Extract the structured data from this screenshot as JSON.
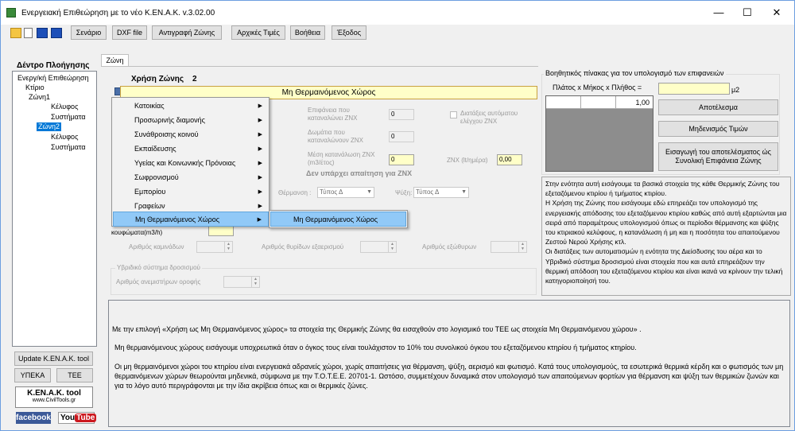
{
  "window": {
    "title": "Ενεργειακή Επιθεώρηση με το νέο Κ.ΕΝ.Α.Κ. v.3.02.00",
    "minimize": "—",
    "maximize": "☐",
    "close": "✕"
  },
  "toolbar": {
    "scenario": "Σενάριο",
    "dxf": "DXF file",
    "copy_zone": "Αντιγραφή Ζώνης",
    "initial_values": "Αρχικές Τιμές",
    "help": "Βοήθεια",
    "exit": "Έξοδος"
  },
  "tree": {
    "title": "Δέντρο Πλοήγησης",
    "items": [
      "Ενεργ/κή Επιθεώρηση",
      "Κτίριο",
      "Ζώνη1",
      "Κέλυφος",
      "Συστήματα",
      "Ζώνη2",
      "Κέλυφος",
      "Συστήματα"
    ]
  },
  "left_buttons": {
    "update": "Update K.EN.A.K. tool",
    "ypeka": "ΥΠΕΚΑ",
    "tee": "ΤΕΕ",
    "logo_title": "K.EN.A.K. tool",
    "logo_sub": "www.CivilTools.gr",
    "facebook": "facebook",
    "youtube_you": "You",
    "youtube_tube": "Tube"
  },
  "tab": {
    "label": "Ζώνη"
  },
  "zone": {
    "usage_label": "Χρήση Ζώνης",
    "number": "2",
    "usage_value": "Μη Θερμαινόμενος Χώρος"
  },
  "context_menu": {
    "items": [
      "Κατοικίας",
      "Προσωρινής διαμονής",
      "Συνάθροισης κοινού",
      "Εκπαίδευσης",
      "Υγείας και Κοινωνικής Πρόνοιας",
      "Σωφρονισμού",
      "Εμπορίου",
      "Γραφείων",
      "Μη Θερμαινόμενος Χώρος"
    ],
    "submenu_item": "Μη Θερμαινόμενος Χώρος"
  },
  "form": {
    "surfaces_znx_label": "Επιφάνεια που καταναλώνει ZNX",
    "surfaces_znx_value": "0",
    "rooms_znx_label": "Δωμάτια που καταναλώνουν ZNX",
    "rooms_znx_value": "0",
    "avg_consumption_label": "Μέση κατανάλωση ZNX (m3/έτος)",
    "avg_consumption_value": "0",
    "znx_per_day_label": "ZNX (lt/ημέρα)",
    "znx_per_day_value": "0,00",
    "no_requirement": "Δεν υπάρχει απαίτηση για ZNX",
    "auto_control_label": "Διατάξεις αυτόματου ελέγχου ZNX",
    "heating_label": "Θέρμανση :",
    "heating_value": "Τύπος Δ",
    "cooling_label": "Ψύξη:",
    "cooling_value": "Τύπος Δ",
    "frames_label": "κουφώματα(m3/h)",
    "chimneys_label": "Αριθμός καμινάδων",
    "vent_openings_label": "Αριθμός θυρίδων εξαερισμού",
    "exhaust_label": "Αριθμός εξώθυρων",
    "hybrid_group": "Υβριδικό σύστημα δροσισμού",
    "ceiling_fans_label": "Αριθμός ανεμιστήρων οροφής"
  },
  "helper": {
    "title": "Βοηθητικός πίνακας για τον υπολογισμό των επιφανειών",
    "formula": "Πλάτος  x  Μήκος  x  Πλήθος   =",
    "result_unit": "μ2",
    "grid_value": "1,00",
    "btn_result": "Αποτέλεσμα",
    "btn_reset": "Μηδενισμός Τιμών",
    "btn_insert": "Εισαγωγή του αποτελέσματος ώς Συνολική Επιφάνεια Ζώνης"
  },
  "info_text": "Στην ενότητα αυτή εισάγουμε τα βασικά στοιχεία της κάθε Θερμικής Ζώνης του εξεταζόμενου κτιρίου ή τμήματος κτιρίου.\nΗ Χρήση της Ζώνης που εισάγουμε εδώ επηρεάζει τον υπολογισμό της ενεργειακής απόδοσης του εξεταζόμενου κτιρίου καθώς από αυτή εξαρτώνται μια σειρά από παραμέτρους υπολογισμού όπως οι περίοδοι θέρμανσης και ψύξης του κτιριακού κελύφους, η κατανάλωση ή μη και η ποσότητα του απαιτούμενου Ζεστού Νερού Χρήσης κτλ.\nΟι διατάξεις των αυτοματισμών η ενότητα της Διείσδυσης του αέρα και το Υβριδικό σύστημα δροσισμού είναι στοιχεία που και αυτά επηρεάζουν την θερμική απόδοση του εξεταζόμενου κτιρίου και είναι ικανά να κρίνουν την τελική κατηγοριοποίησή του.",
  "bottom_text": {
    "p1": "Με την επιλογή «Χρήση ως Μη Θερμαινόμενος χώρος» τα στοιχεία της Θερμικής Ζώνης θα εισαχθούν στο λογισμικό του ΤΕΕ ως στοιχεία Μη Θερμαινόμενου χώρου» .",
    "p2": "Μη θερμαινόμενους χώρους εισάγουμε υποχρεωτικά όταν ο όγκος τους είναι τουλάχιστον το 10% του συνολικού όγκου του εξεταζόμενου κτηρίου ή τμήματος κτηρίου.",
    "p3": "Οι μη θερμαινόμενοι χώροι του κτηρίου είναι ενεργειακά αδρανείς χώροι, χωρίς απαιτήσεις για θέρμανση, ψύξη, αερισμό και φωτισμό. Κατά τους υπολογισμούς, τα εσωτερικά θερμικά κέρδη και ο φωτισμός των μη θερμαινόμενων χώρων θεωρούνται μηδενικά, σύμφωνα με την Τ.Ο.Τ.Ε.Ε. 20701-1. Ωστόσο, συμμετέχουν δυναμικά στον υπολογισμό των απαιτούμενων φορτίων για θέρμανση και ψύξη των θερμικών ζωνών και για το λόγο αυτό περιγράφονται με την ίδια ακρίβεια όπως και οι θερμικές ζώνες."
  }
}
